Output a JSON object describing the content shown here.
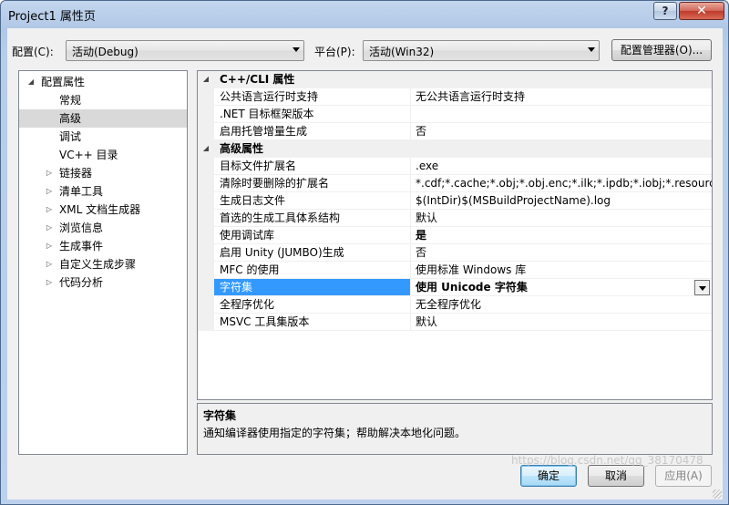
{
  "window": {
    "title": "Project1 属性页",
    "help_label": "?",
    "close_label": "✕"
  },
  "toolbar": {
    "config_label": "配置(C):",
    "config_value": "活动(Debug)",
    "platform_label": "平台(P):",
    "platform_value": "活动(Win32)",
    "config_manager_label": "配置管理器(O)..."
  },
  "tree": {
    "items": [
      {
        "label": "配置属性",
        "expander": "◢",
        "level": 0
      },
      {
        "label": "常规",
        "expander": "",
        "level": 1
      },
      {
        "label": "高级",
        "expander": "",
        "level": 1,
        "selected": true
      },
      {
        "label": "调试",
        "expander": "",
        "level": 1
      },
      {
        "label": "VC++ 目录",
        "expander": "",
        "level": 1
      },
      {
        "label": "链接器",
        "expander": "▷",
        "level": 1
      },
      {
        "label": "清单工具",
        "expander": "▷",
        "level": 1
      },
      {
        "label": "XML 文档生成器",
        "expander": "▷",
        "level": 1
      },
      {
        "label": "浏览信息",
        "expander": "▷",
        "level": 1
      },
      {
        "label": "生成事件",
        "expander": "▷",
        "level": 1
      },
      {
        "label": "自定义生成步骤",
        "expander": "▷",
        "level": 1
      },
      {
        "label": "代码分析",
        "expander": "▷",
        "level": 1
      }
    ]
  },
  "grid": {
    "rows": [
      {
        "type": "cat",
        "name": "C++/CLI 属性",
        "expander": "◢"
      },
      {
        "type": "prop",
        "name": "公共语言运行时支持",
        "value": "无公共语言运行时支持"
      },
      {
        "type": "prop",
        "name": ".NET 目标框架版本",
        "value": ""
      },
      {
        "type": "prop",
        "name": "启用托管增量生成",
        "value": "否"
      },
      {
        "type": "cat",
        "name": "高级属性",
        "expander": "◢"
      },
      {
        "type": "prop",
        "name": "目标文件扩展名",
        "value": ".exe"
      },
      {
        "type": "prop",
        "name": "清除时要删除的扩展名",
        "value": "*.cdf;*.cache;*.obj;*.obj.enc;*.ilk;*.ipdb;*.iobj;*.resources;*"
      },
      {
        "type": "prop",
        "name": "生成日志文件",
        "value": "$(IntDir)$(MSBuildProjectName).log"
      },
      {
        "type": "prop",
        "name": "首选的生成工具体系结构",
        "value": "默认"
      },
      {
        "type": "prop",
        "name": "使用调试库",
        "value": "是",
        "bold": true
      },
      {
        "type": "prop",
        "name": "启用 Unity (JUMBO)生成",
        "value": "否"
      },
      {
        "type": "prop",
        "name": "MFC 的使用",
        "value": "使用标准 Windows 库"
      },
      {
        "type": "prop",
        "name": "字符集",
        "value": "使用 Unicode 字符集",
        "bold": true,
        "selected": true
      },
      {
        "type": "prop",
        "name": "全程序优化",
        "value": "无全程序优化"
      },
      {
        "type": "prop",
        "name": "MSVC 工具集版本",
        "value": "默认"
      }
    ]
  },
  "description": {
    "title": "字符集",
    "text": "通知编译器使用指定的字符集；帮助解决本地化问题。"
  },
  "buttons": {
    "ok": "确定",
    "cancel": "取消",
    "apply": "应用(A)"
  },
  "watermark": "https://blog.csdn.net/qq_38170478"
}
